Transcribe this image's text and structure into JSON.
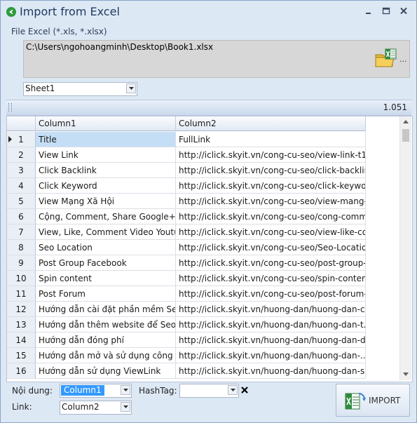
{
  "window": {
    "title": "Import from Excel",
    "controls": [
      "minimize-icon",
      "maximize-icon",
      "close-icon"
    ]
  },
  "file": {
    "label": "File Excel (*.xls, *.xlsx)",
    "path": "C:\\Users\\ngohoangminh\\Desktop\\Book1.xlsx",
    "browse_icon": "excel-folder-icon",
    "more": "..."
  },
  "sheet_select": {
    "value": "Sheet1"
  },
  "group_panel": {
    "count": "1.051"
  },
  "table": {
    "columns": [
      "Column1",
      "Column2"
    ],
    "rows": [
      {
        "num": "1",
        "c1": "Title",
        "c2": "FullLink"
      },
      {
        "num": "2",
        "c1": "View Link",
        "c2": "http://iclick.skyit.vn/cong-cu-seo/view-link-t1..."
      },
      {
        "num": "3",
        "c1": "Click Backlink",
        "c2": "http://iclick.skyit.vn/cong-cu-seo/click-backlin..."
      },
      {
        "num": "4",
        "c1": "Click Keyword",
        "c2": "http://iclick.skyit.vn/cong-cu-seo/click-keywor..."
      },
      {
        "num": "5",
        "c1": "View Mạng Xã Hội",
        "c2": "http://iclick.skyit.vn/cong-cu-seo/view-mang-..."
      },
      {
        "num": "6",
        "c1": "Cộng, Comment, Share Google+",
        "c2": "http://iclick.skyit.vn/cong-cu-seo/cong-comm..."
      },
      {
        "num": "7",
        "c1": "View, Like, Comment Video Youtu...",
        "c2": "http://iclick.skyit.vn/cong-cu-seo/view-like-co..."
      },
      {
        "num": "8",
        "c1": "Seo Location",
        "c2": "http://iclick.skyit.vn/cong-cu-seo/Seo-Locatio..."
      },
      {
        "num": "9",
        "c1": "Post Group Facebook",
        "c2": "http://iclick.skyit.vn/cong-cu-seo/post-group-..."
      },
      {
        "num": "10",
        "c1": "Spin content",
        "c2": "http://iclick.skyit.vn/cong-cu-seo/spin-conten..."
      },
      {
        "num": "11",
        "c1": "Post Forum",
        "c2": "http://iclick.skyit.vn/cong-cu-seo/post-forum-..."
      },
      {
        "num": "12",
        "c1": "Hướng dẫn cài đặt phần mềm Se...",
        "c2": "http://iclick.skyit.vn/huong-dan/huong-dan-c..."
      },
      {
        "num": "13",
        "c1": "Hướng dẫn thêm website để Seo",
        "c2": "http://iclick.skyit.vn/huong-dan/huong-dan-t..."
      },
      {
        "num": "14",
        "c1": "Hướng dẫn đóng phí",
        "c2": "http://iclick.skyit.vn/huong-dan/huong-dan-d..."
      },
      {
        "num": "15",
        "c1": "Hướng dẫn mở và sử dụng công ...",
        "c2": "http://iclick.skyit.vn/huong-dan/huong-dan-..."
      },
      {
        "num": "16",
        "c1": "Hướng dẫn sử dụng ViewLink",
        "c2": "http://iclick.skyit.vn/huong-dan/huong-dan-s..."
      }
    ],
    "selected_row": "1"
  },
  "form": {
    "content_label": "Nội dung:",
    "content_value": "Column1",
    "link_label": "Link:",
    "link_value": "Column2",
    "hashtag_label": "HashTag:",
    "hashtag_value": ""
  },
  "import_button": {
    "label": "IMPORT",
    "icon": "excel-import-icon"
  },
  "colors": {
    "window_bg": "#dde8f5",
    "title_text": "#1e3a5f",
    "selection": "#3399ff",
    "row_selected": "#c4def5"
  }
}
